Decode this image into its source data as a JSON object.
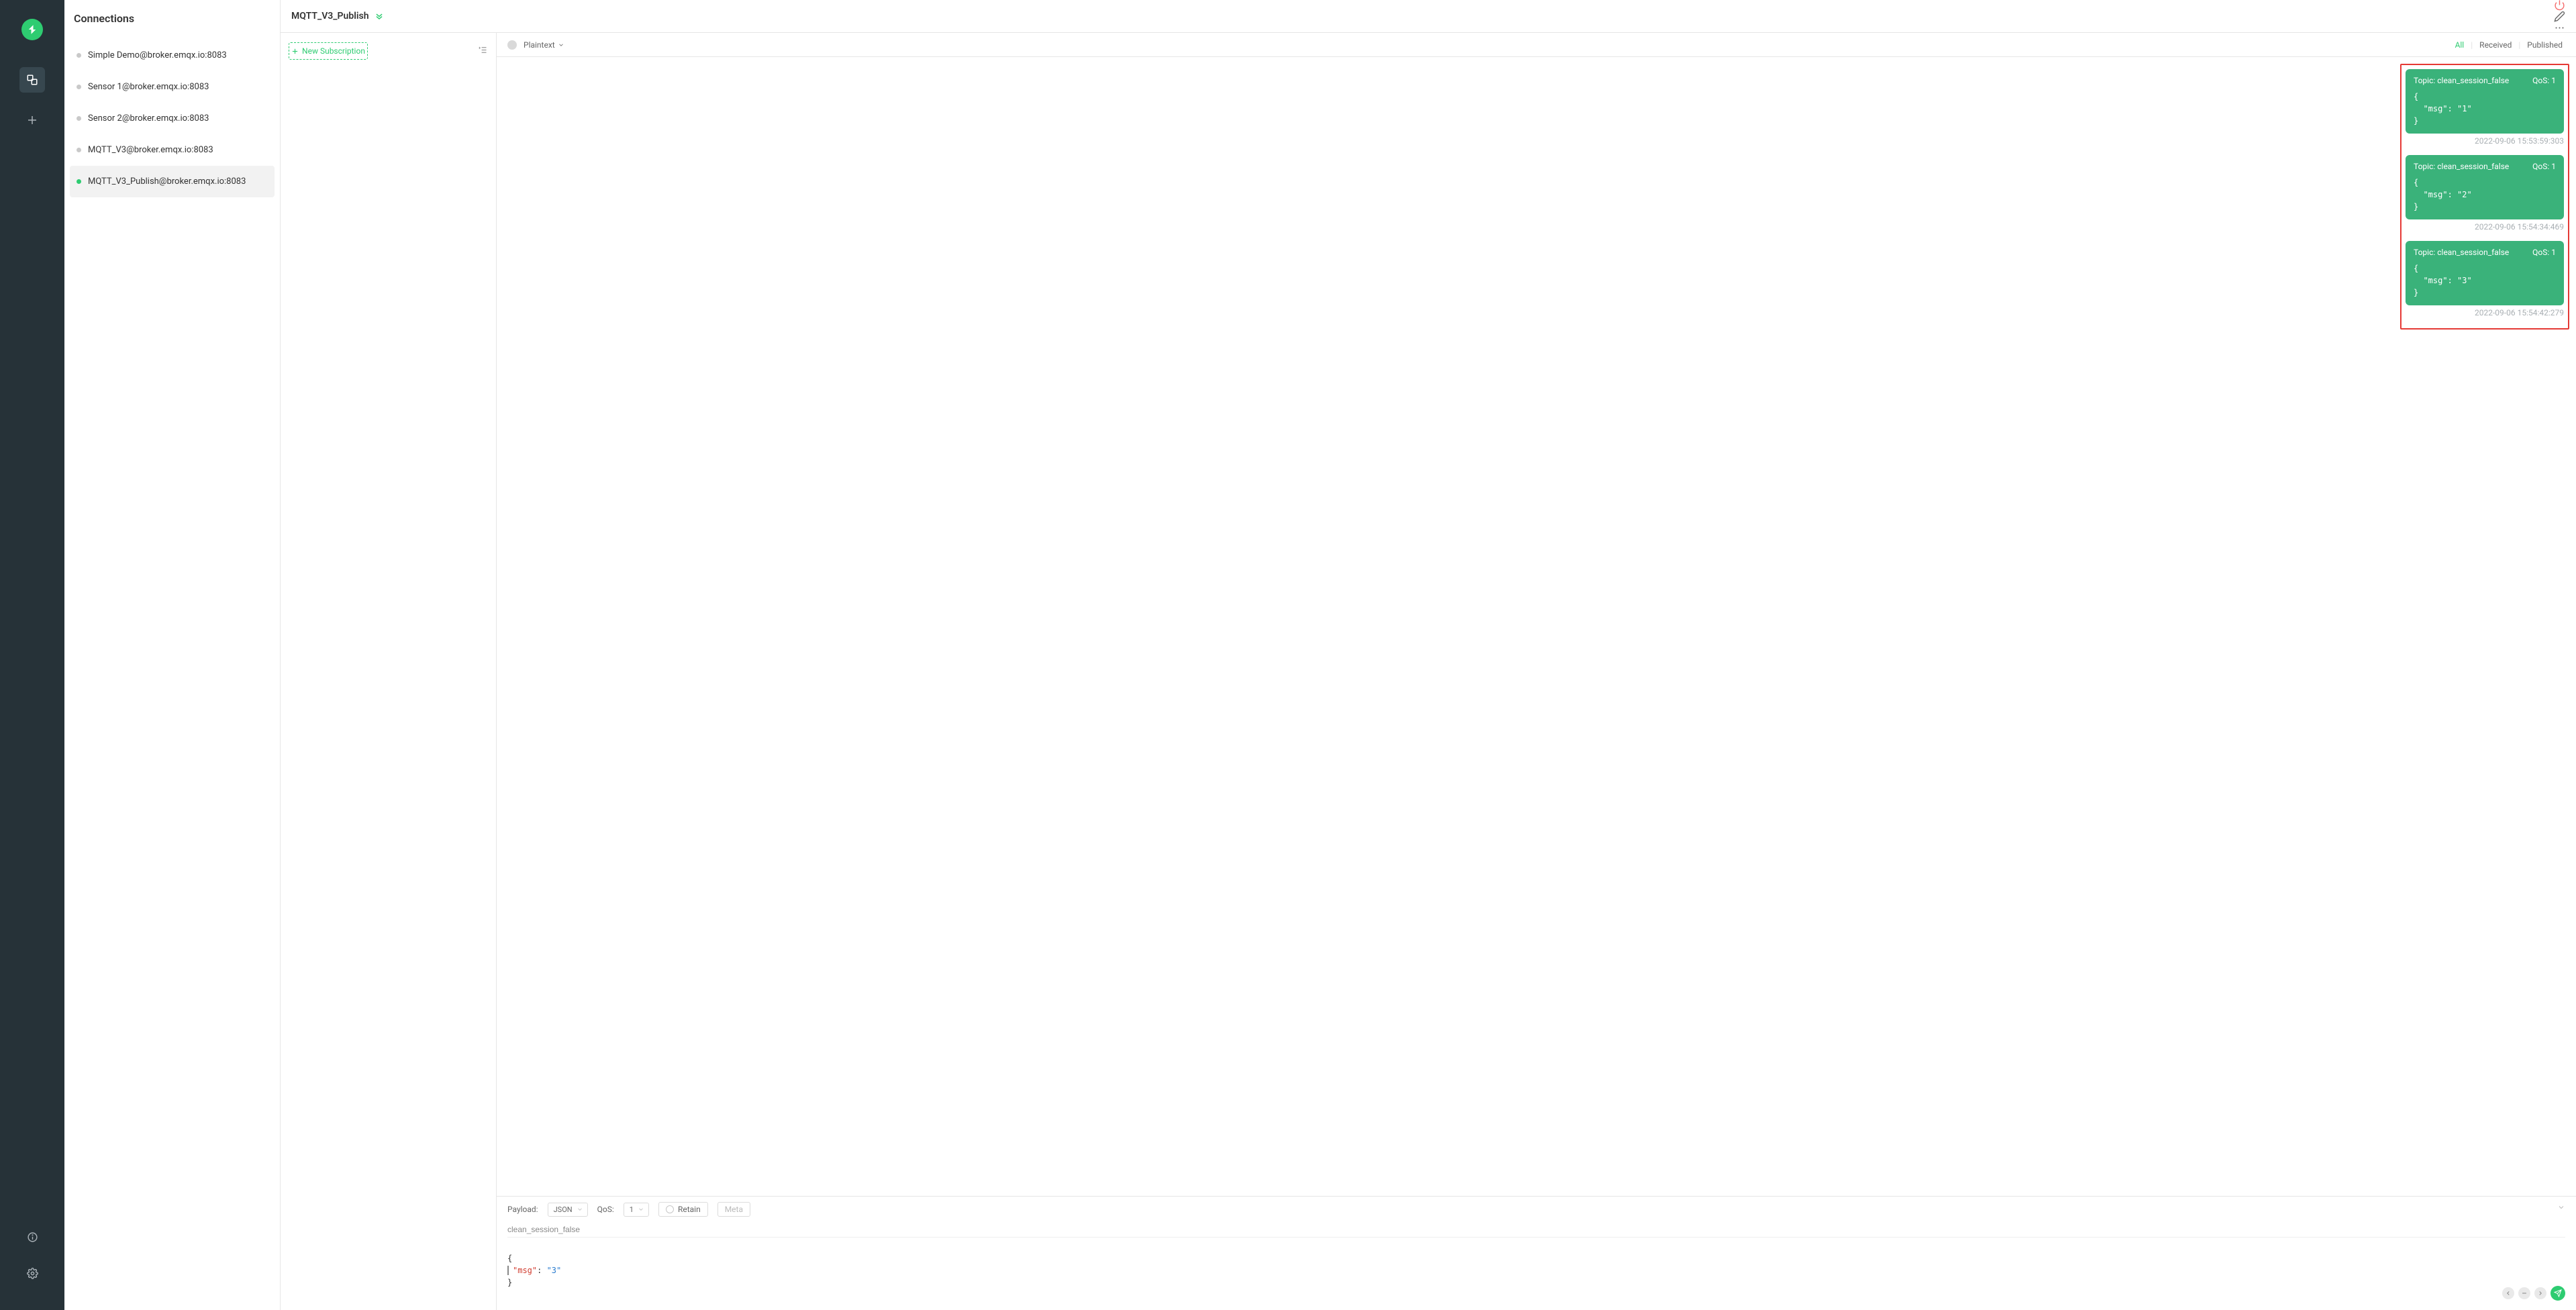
{
  "sidebar": {
    "title": "Connections",
    "items": [
      {
        "label": "Simple Demo@broker.emqx.io:8083",
        "status": "offline"
      },
      {
        "label": "Sensor 1@broker.emqx.io:8083",
        "status": "offline"
      },
      {
        "label": "Sensor 2@broker.emqx.io:8083",
        "status": "offline"
      },
      {
        "label": "MQTT_V3@broker.emqx.io:8083",
        "status": "offline"
      },
      {
        "label": "MQTT_V3_Publish@broker.emqx.io:8083",
        "status": "online"
      }
    ]
  },
  "topbar": {
    "title": "MQTT_V3_Publish"
  },
  "sub_panel": {
    "new_label": "New Subscription"
  },
  "msg_toolbar": {
    "format": "Plaintext",
    "tabs": {
      "all": "All",
      "received": "Received",
      "published": "Published"
    }
  },
  "messages": [
    {
      "topic_label": "Topic: clean_session_false",
      "qos_label": "QoS: 1",
      "body": "{\n  \"msg\": \"1\"\n}",
      "time": "2022-09-06 15:53:59:303"
    },
    {
      "topic_label": "Topic: clean_session_false",
      "qos_label": "QoS: 1",
      "body": "{\n  \"msg\": \"2\"\n}",
      "time": "2022-09-06 15:54:34:469"
    },
    {
      "topic_label": "Topic: clean_session_false",
      "qos_label": "QoS: 1",
      "body": "{\n  \"msg\": \"3\"\n}",
      "time": "2022-09-06 15:54:42:279"
    }
  ],
  "publisher": {
    "payload_label": "Payload:",
    "payload_format": "JSON",
    "qos_label": "QoS:",
    "qos_value": "1",
    "retain_label": "Retain",
    "meta_label": "Meta",
    "topic": "clean_session_false",
    "body_open": "{",
    "body_key": "\"msg\"",
    "body_colon": ": ",
    "body_val": "\"3\"",
    "body_close": "}"
  }
}
